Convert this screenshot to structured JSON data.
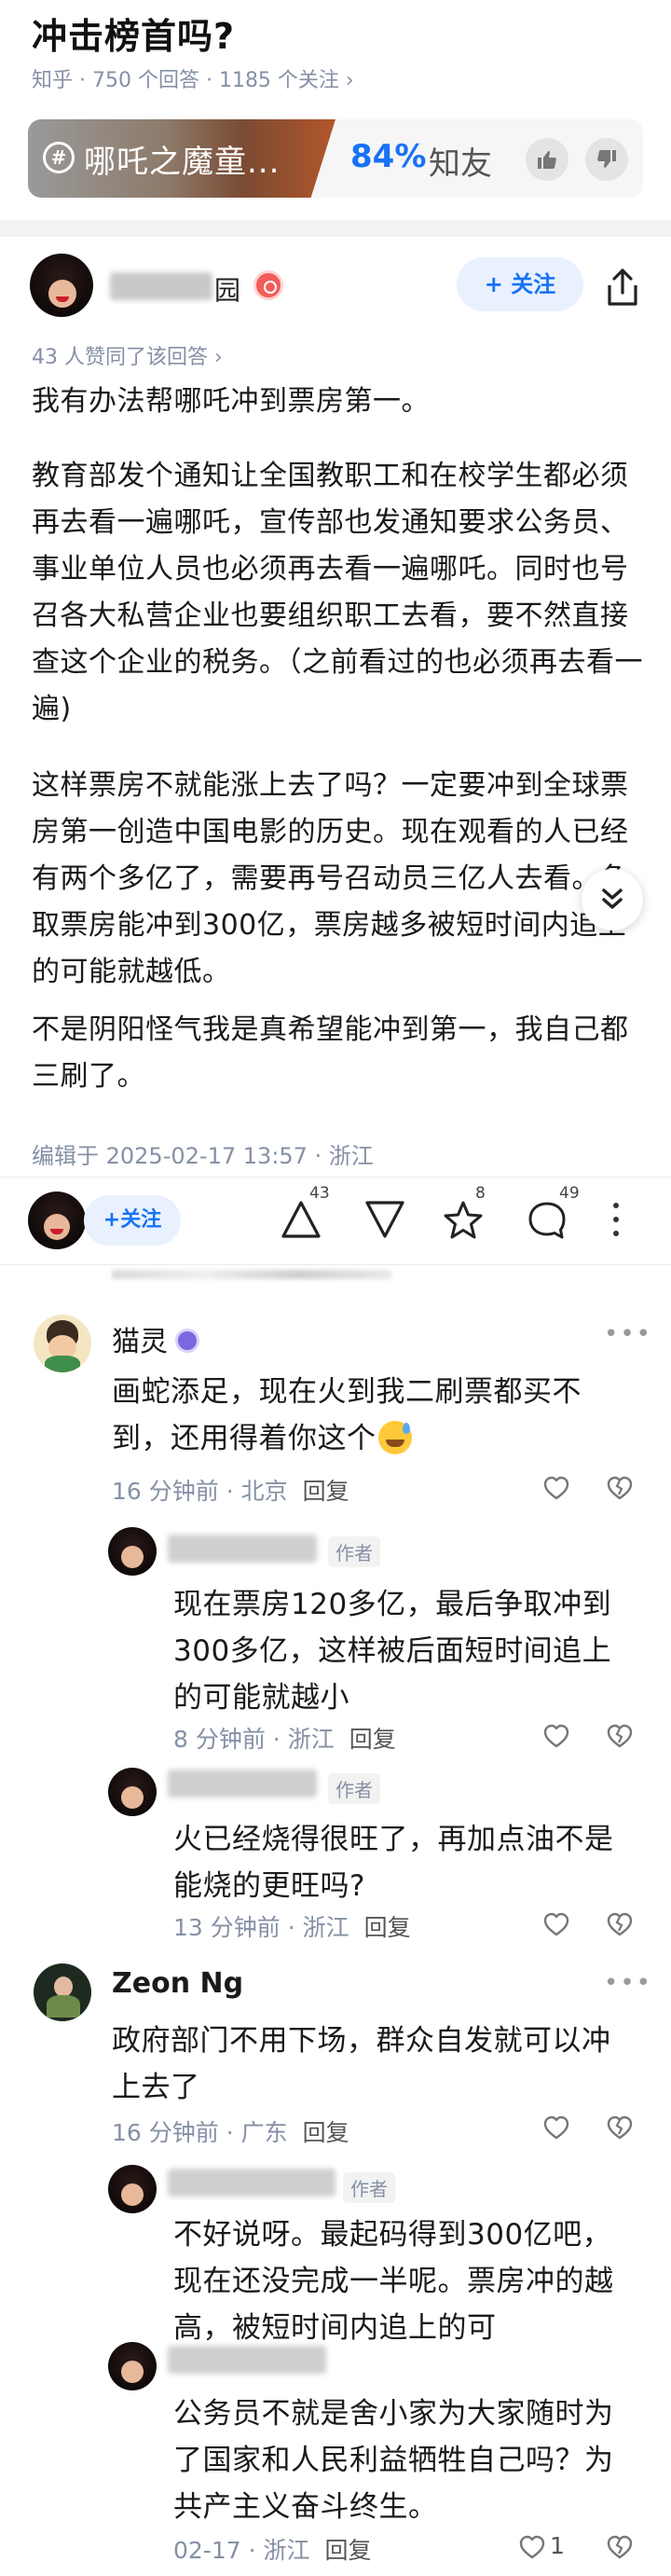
{
  "question": {
    "title": "冲击榜首吗?",
    "meta": "知乎 · 750 个回答 · 1185 个关注 ›"
  },
  "banner": {
    "tag": "哪吒之魔童...",
    "percent": "84%",
    "friend_label": "知友"
  },
  "answer": {
    "author_name_suffix": "园",
    "follow_label": "+ 关注",
    "approve_line": "43 人赞同了该回答 ›",
    "paragraphs": [
      "我有办法帮哪吒冲到票房第一。",
      "教育部发个通知让全国教职工和在校学生都必须再去看一遍哪吒，宣传部也发通知要求公务员、事业单位人员也必须再去看一遍哪吒。同时也号召各大私营企业也要组织职工去看，要不然直接查这个企业的税务。（之前看过的也必须再去看一遍)",
      "这样票房不就能涨上去了吗？一定要冲到全球票房第一创造中国电影的历史。现在观看的人已经有两个多亿了，需要再号召动员三亿人去看。争取票房能冲到300亿，票房越多被短时间内追上的可能就越低。",
      "不是阴阳怪气我是真希望能冲到第一，我自己都三刷了。"
    ],
    "edit_line": "编辑于 2025-02-17 13:57 · 浙江"
  },
  "action_bar": {
    "follow_label": "+关注",
    "upvote_count": "43",
    "star_count": "8",
    "comment_count": "49"
  },
  "comments": [
    {
      "name": "猫灵",
      "text": "画蛇添足，现在火到我二刷票都买不到，还用得着你这个",
      "time": "16 分钟前",
      "location": "北京",
      "reply_label": "回复",
      "replies": [
        {
          "author_tag": "作者",
          "text": "现在票房120多亿，最后争取冲到300多亿，这样被后面短时间追上的可能就越小",
          "time": "8 分钟前",
          "location": "浙江",
          "reply_label": "回复"
        },
        {
          "author_tag": "作者",
          "text": "火已经烧得很旺了，再加点油不是能烧的更旺吗?",
          "time": "13 分钟前",
          "location": "浙江",
          "reply_label": "回复"
        }
      ]
    },
    {
      "name": "Zeon Ng",
      "text": "政府部门不用下场，群众自发就可以冲上去了",
      "time": "16 分钟前",
      "location": "广东",
      "reply_label": "回复",
      "replies": [
        {
          "author_tag": "作者",
          "text": "不好说呀。最起码得到300亿吧，现在还没完成一半呢。票房冲的越高，被短时间内追上的可",
          "time": "",
          "location": "",
          "reply_label": ""
        },
        {
          "author_tag": "",
          "text": "公务员不就是舍小家为大家随时为了国家和人民利益牺牲自己吗？为共产主义奋斗终生。",
          "time": "02-17",
          "location": "浙江",
          "reply_label": "回复",
          "like_count": "1"
        }
      ]
    }
  ],
  "colors": {
    "accent": "#1772f6",
    "meta": "#8590a6",
    "follow_bg": "#eaf1fe"
  }
}
